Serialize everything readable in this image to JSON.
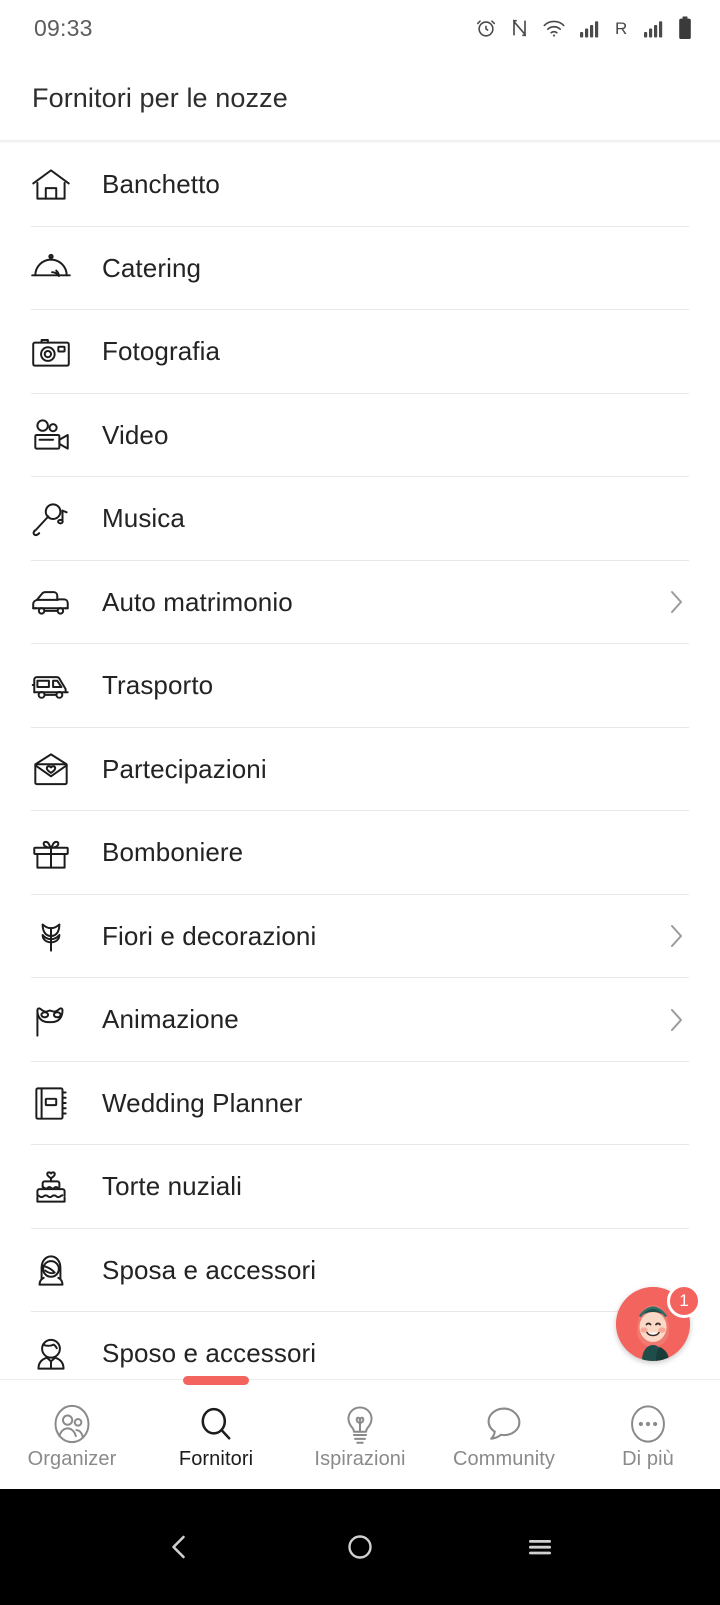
{
  "statusbar": {
    "time": "09:33",
    "icons": [
      "alarm-icon",
      "nfc-icon",
      "wifi-icon",
      "signal-icon",
      "roaming-icon",
      "signal-2-icon",
      "battery-icon"
    ]
  },
  "header": {
    "title": "Fornitori per le nozze"
  },
  "list": {
    "items": [
      {
        "label": "Banchetto",
        "icon": "house-icon",
        "chevron": false
      },
      {
        "label": "Catering",
        "icon": "cloche-icon",
        "chevron": false
      },
      {
        "label": "Fotografia",
        "icon": "camera-icon",
        "chevron": false
      },
      {
        "label": "Video",
        "icon": "videocamera-icon",
        "chevron": false
      },
      {
        "label": "Musica",
        "icon": "microphone-icon",
        "chevron": false
      },
      {
        "label": "Auto matrimonio",
        "icon": "car-icon",
        "chevron": true
      },
      {
        "label": "Trasporto",
        "icon": "bus-icon",
        "chevron": false
      },
      {
        "label": "Partecipazioni",
        "icon": "envelope-icon",
        "chevron": false
      },
      {
        "label": "Bomboniere",
        "icon": "gift-icon",
        "chevron": false
      },
      {
        "label": "Fiori e decorazioni",
        "icon": "tulip-icon",
        "chevron": true
      },
      {
        "label": "Animazione",
        "icon": "mask-icon",
        "chevron": true
      },
      {
        "label": "Wedding Planner",
        "icon": "notebook-icon",
        "chevron": false
      },
      {
        "label": "Torte nuziali",
        "icon": "cake-icon",
        "chevron": false
      },
      {
        "label": "Sposa e accessori",
        "icon": "bride-icon",
        "chevron": false
      },
      {
        "label": "Sposo e accessori",
        "icon": "groom-icon",
        "chevron": false
      }
    ]
  },
  "fab": {
    "badge_count": "1",
    "icon": "avatar-icon"
  },
  "bottomnav": {
    "active_index": 1,
    "items": [
      {
        "label": "Organizer",
        "icon": "people-circle-icon"
      },
      {
        "label": "Fornitori",
        "icon": "search-icon"
      },
      {
        "label": "Ispirazioni",
        "icon": "lightbulb-icon"
      },
      {
        "label": "Community",
        "icon": "speech-bubble-icon"
      },
      {
        "label": "Di più",
        "icon": "more-dots-icon"
      }
    ]
  },
  "sysbar": {
    "items": [
      "back-icon",
      "home-icon",
      "recents-icon"
    ]
  },
  "colors": {
    "accent": "#f4645f",
    "text": "#232323",
    "muted": "#8a8a8a",
    "divider": "#e8e8e8"
  }
}
